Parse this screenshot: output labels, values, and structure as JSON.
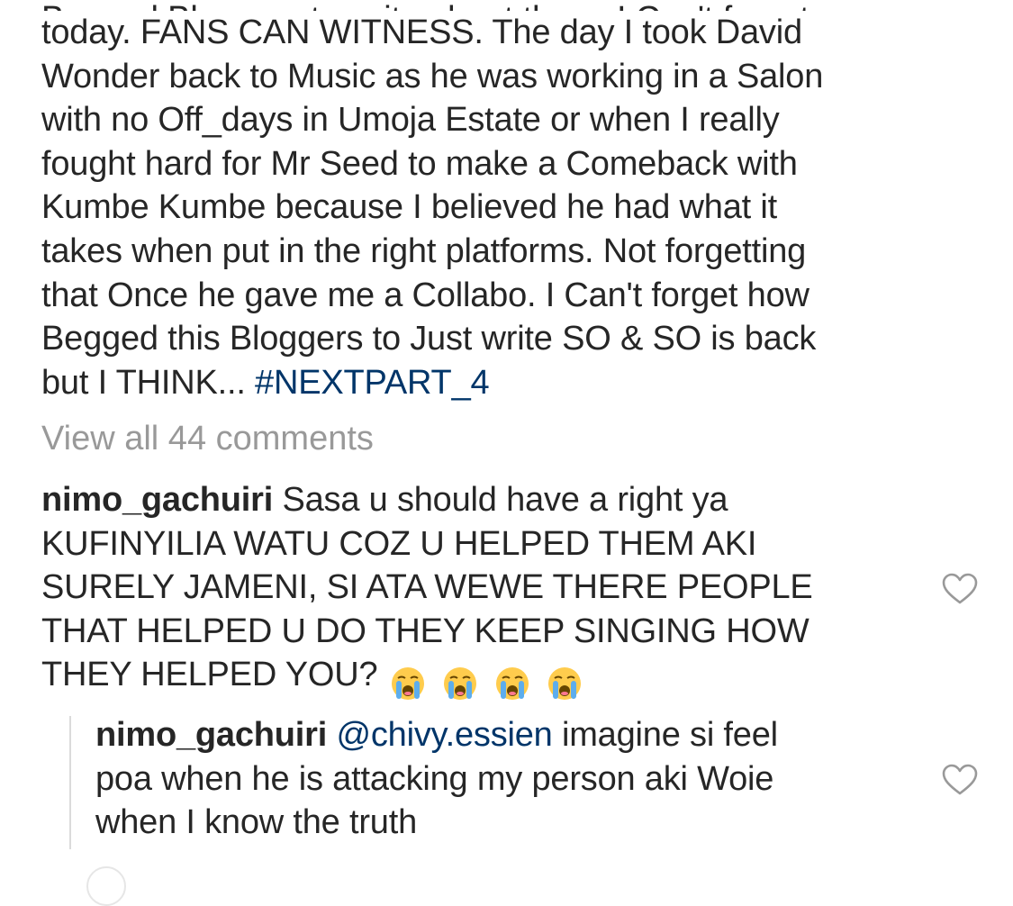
{
  "caption": {
    "lines": [
      "today. FANS CAN WITNESS. The day I took David",
      "Wonder back to Music as he was working in a Salon",
      "with no Off_days in Umoja Estate or when I really",
      "fought hard for Mr Seed to make a Comeback with",
      "Kumbe Kumbe because I believed he had what it",
      "takes when put in the right platforms. Not forgetting",
      "that Once he gave me a Collabo. I Can't forget how",
      "Begged this Bloggers to Just  write SO & SO is back"
    ],
    "last_line_text": "but I THINK... ",
    "hashtag": "#NEXTPART_4"
  },
  "view_all_comments": "View all 44 comments",
  "comments": [
    {
      "username": "nimo_gachuiri",
      "first_line_text": " Sasa u should have a right ya",
      "lines": [
        "KUFINYILIA WATU COZ U HELPED THEM AKI",
        "SURELY JAMENI, SI ATA WEWE THERE PEOPLE",
        "THAT HELPED U DO THEY KEEP SINGING HOW"
      ],
      "last_line_text": "THEY HELPED YOU?",
      "emojis": [
        "crying-face",
        "crying-face",
        "crying-face",
        "crying-face"
      ],
      "like_icon": "heart-outline-icon"
    },
    {
      "username": "nimo_gachuiri",
      "mention": "@chivy.essien",
      "first_line_text": " imagine si feel",
      "lines": [
        "poa when he is attacking my person aki Woie",
        "when I know the truth"
      ],
      "like_icon": "heart-outline-icon"
    }
  ],
  "colors": {
    "text": "#262626",
    "hashtag": "#003569",
    "muted": "#999999",
    "reply_bar": "#dbdbdb"
  }
}
